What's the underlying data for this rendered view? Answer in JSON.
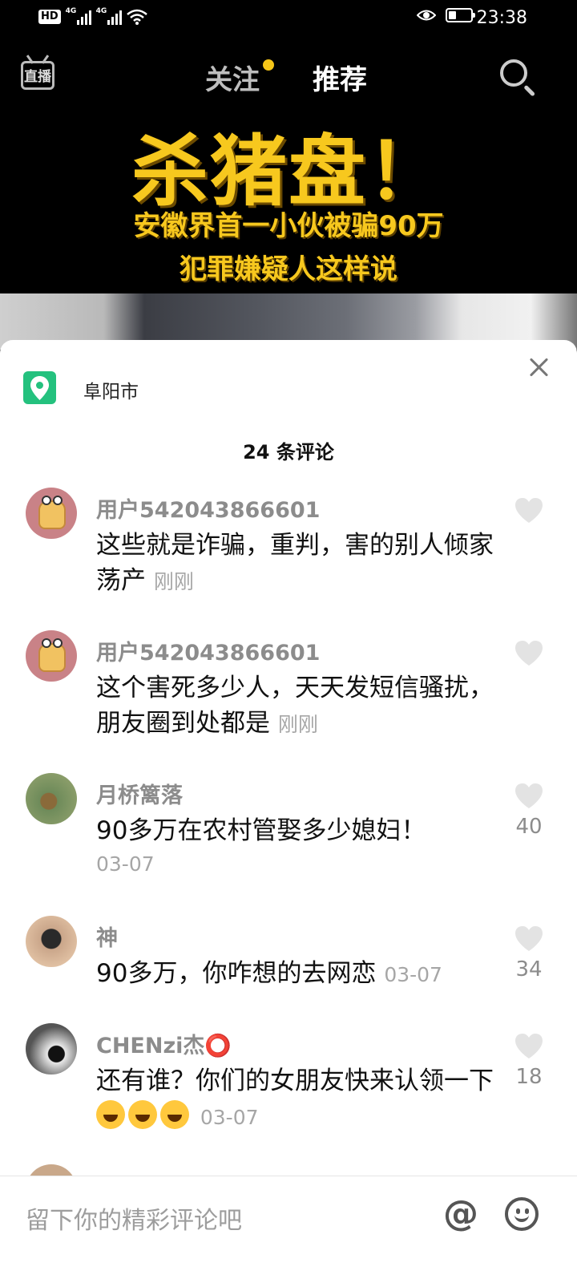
{
  "status_bar": {
    "hd": "HD",
    "sim1": "4G",
    "sim2": "4G",
    "time": "23:38",
    "battery_level": 0.35,
    "icons": [
      "hd-icon",
      "signal-icon",
      "signal-icon",
      "wifi-icon",
      "eye-icon",
      "battery-icon"
    ]
  },
  "top_nav": {
    "live_label": "直播",
    "tabs": [
      {
        "label": "关注",
        "has_dot": true
      },
      {
        "label": "推荐",
        "active": true
      }
    ],
    "search_icon": "search-icon",
    "dot_color": "#f5c518"
  },
  "video": {
    "title": "杀猪盘！",
    "subtitle_line1": "安徽界首一小伙被骗90万",
    "subtitle_line2": "犯罪嫌疑人这样说",
    "title_color": "#f7c81e"
  },
  "sheet": {
    "location_icon": "location-pin-icon",
    "location": "阜阳市",
    "close_icon": "close-icon",
    "comment_count_label": "24 条评论",
    "accent_color": "#24c17e"
  },
  "comments": [
    {
      "user": "用户542043866601",
      "text": "这些就是诈骗，重判，害的别人倾家荡产",
      "time": "刚刚",
      "likes": ""
    },
    {
      "user": "用户542043866601",
      "text": "这个害死多少人，天天发短信骚扰，朋友圈到处都是",
      "time": "刚刚",
      "likes": ""
    },
    {
      "user": "月桥篱落",
      "text": "90多万在农村管娶多少媳妇！",
      "time": "03-07",
      "likes": "40"
    },
    {
      "user": "神",
      "text": "90多万，你咋想的去网恋",
      "time": "03-07",
      "likes": "34"
    },
    {
      "user": "CHENzi杰⭕",
      "text": "还有谁？你们的女朋友快来认领一下",
      "time": "03-07",
      "likes": "18",
      "emojis": 3
    }
  ],
  "input_bar": {
    "placeholder": "留下你的精彩评论吧",
    "mention_label": "@",
    "emoji_icon": "emoji-icon"
  }
}
